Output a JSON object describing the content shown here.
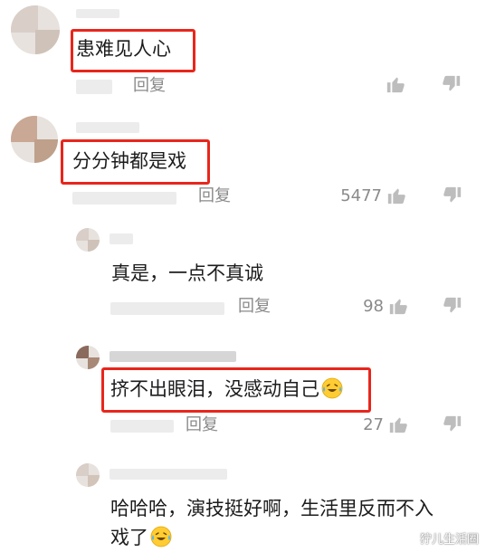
{
  "comments": [
    {
      "text": "患难见人心",
      "reply_label": "回复",
      "likes": ""
    },
    {
      "text": "分分钟都是戏",
      "reply_label": "回复",
      "likes": "5477"
    }
  ],
  "replies": [
    {
      "text": "真是，一点不真诚",
      "reply_label": "回复",
      "likes": "98"
    },
    {
      "text": "挤不出眼泪，没感动自己",
      "reply_label": "回复",
      "likes": "27",
      "emoji": "crying-laughing-emoji"
    },
    {
      "text_line1": "哈哈哈，演技挺好啊，生活里反而不入",
      "text_line2": "戏了",
      "emoji": "crying-laughing-emoji"
    }
  ],
  "watermark": "狞儿生活圈",
  "colors": {
    "highlight": "#e8261c",
    "muted": "#8a8a8a"
  },
  "icons": {
    "like": "thumbs-up-icon",
    "dislike": "thumbs-down-icon"
  }
}
